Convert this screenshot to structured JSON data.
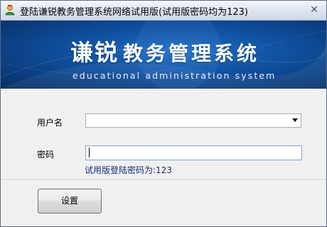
{
  "window": {
    "title": "登陆谦锐教务管理系统网络试用版(试用版密码均为123)",
    "close_glyph": "✕"
  },
  "banner": {
    "brand": "谦锐",
    "title": "教务管理系统",
    "subtitle": "educational administration system",
    "background_color": "#0f4f9e"
  },
  "form": {
    "username_label": "用户名",
    "username_value": "",
    "password_label": "密码",
    "password_value": "",
    "hint": "试用版登陆密码为:123"
  },
  "buttons": {
    "settings_label": "设置"
  },
  "icons": {
    "app": "app-user-icon",
    "close": "close-icon",
    "dropdown": "chevron-down-icon"
  }
}
